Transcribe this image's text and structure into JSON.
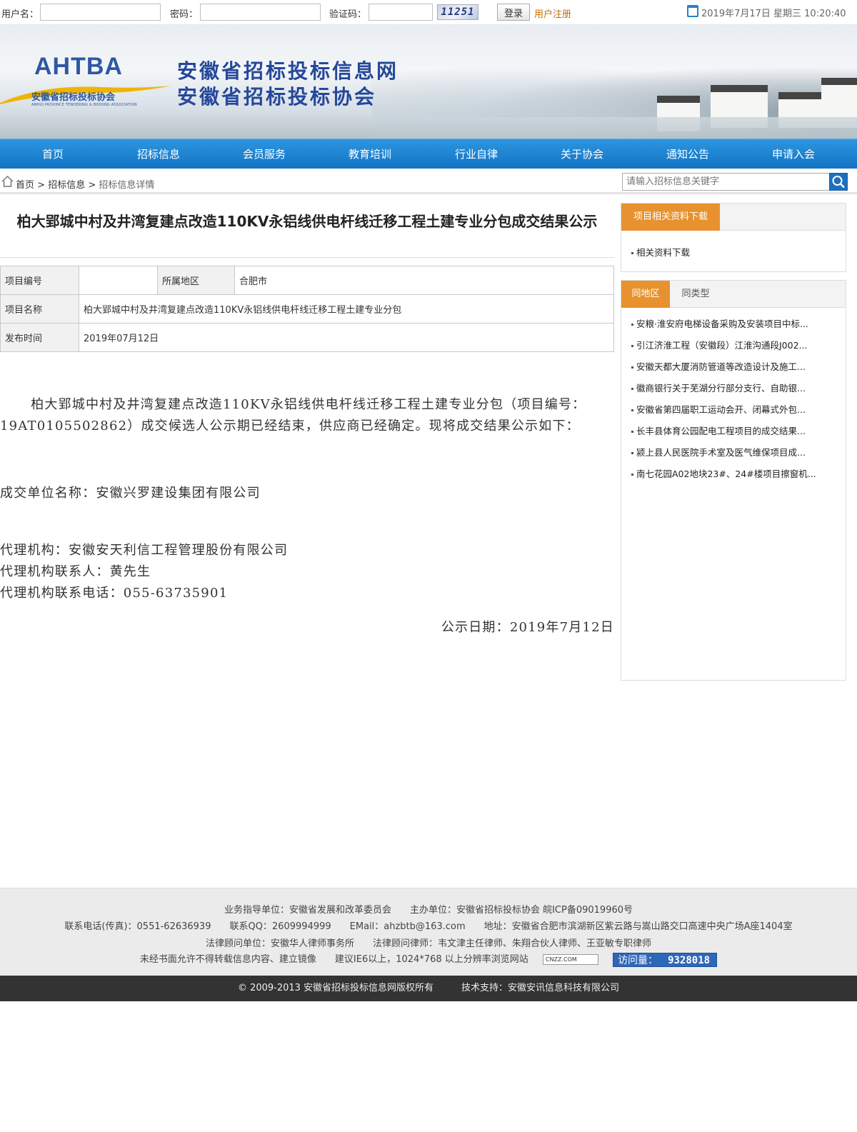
{
  "login": {
    "username_label": "用户名：",
    "password_label": "密码：",
    "captcha_label": "验证码：",
    "captcha_text": "11251",
    "login_button": "登录",
    "register_link": "用户注册",
    "datetime": "2019年7月17日 星期三 10:20:40"
  },
  "header": {
    "logo_abbr": "AHTBA",
    "logo_cn": "安徽省招标投标协会",
    "logo_en": "ANHUI PROVINCE TENDERING & BIDDING ASSOCIATION",
    "site_name_1": "安徽省招标投标信息网",
    "site_name_2": "安徽省招标投标协会"
  },
  "nav": [
    "首页",
    "招标信息",
    "会员服务",
    "教育培训",
    "行业自律",
    "关于协会",
    "通知公告",
    "申请入会"
  ],
  "breadcrumb": {
    "home": "首页",
    "sep": " > ",
    "level1": "招标信息",
    "current": "招标信息详情"
  },
  "search": {
    "placeholder": "请输入招标信息关键字"
  },
  "article": {
    "title": "柏大郢城中村及井湾复建点改造110KV永铝线供电杆线迁移工程土建专业分包成交结果公示",
    "info": {
      "project_no_label": "项目编号",
      "project_no": "",
      "region_label": "所属地区",
      "region": "合肥市",
      "project_name_label": "项目名称",
      "project_name": "柏大郢城中村及井湾复建点改造110KV永铝线供电杆线迁移工程土建专业分包",
      "publish_label": "发布时间",
      "publish_date": "2019年07月12日"
    },
    "para1": "柏大郢城中村及井湾复建点改造110KV永铝线供电杆线迁移工程土建专业分包（项目编号：19AT0105502862）成交候选人公示期已经结束，供应商已经确定。现将成交结果公示如下：",
    "winner": "成交单位名称：安徽兴罗建设集团有限公司",
    "agency": "代理机构：安徽安天利信工程管理股份有限公司",
    "agency_contact": "代理机构联系人：黄先生",
    "agency_phone": "代理机构联系电话：055-63735901",
    "notice_date": "公示日期：2019年7月12日"
  },
  "sidebar": {
    "download_tab": "项目相关资料下载",
    "download_item": "相关资料下载",
    "tab_same_region": "同地区",
    "tab_same_type": "同类型",
    "related": [
      "安粮·淮安府电梯设备采购及安装项目中标...",
      "引江济淮工程（安徽段）江淮沟通段J002...",
      "安徽天都大厦消防管道等改造设计及施工...",
      "徽商银行关于芜湖分行部分支行、自助银...",
      "安徽省第四届职工运动会开、闭幕式外包...",
      "长丰县体育公园配电工程项目的成交结果...",
      "颍上县人民医院手术室及医气维保项目成...",
      "南七花园A02地块23#、24#楼项目擦窗机..."
    ]
  },
  "footer": {
    "line1": "业务指导单位：安徽省发展和改革委员会　　主办单位：安徽省招标投标协会 皖ICP备09019960号",
    "line2": "联系电话(传真)：0551-62636939　　联系QQ：2609994999　　EMail：ahzbtb@163.com　　地址：安徽省合肥市滨湖新区紫云路与嵩山路交口高速中央广场A座1404室",
    "line3": "法律顾问单位：安徽华人律师事务所　　法律顾问律师：韦文津主任律师、朱翔合伙人律师、王亚敏专职律师",
    "line4": "未经书面允许不得转载信息内容、建立镜像　　建议IE6以上，1024*768 以上分辨率浏览网站",
    "cnzz": "CNZZ.COM",
    "visit_label": "访问量：",
    "visit_count": "9328018",
    "copyright": "© 2009-2013 安徽省招标投标信息网版权所有　　　技术支持：安徽安讯信息科技有限公司"
  },
  "colors": {
    "nav_blue": "#1b82d2",
    "accent_orange": "#e7922f",
    "register_orange": "#c07000",
    "footer_dark": "#333333"
  }
}
